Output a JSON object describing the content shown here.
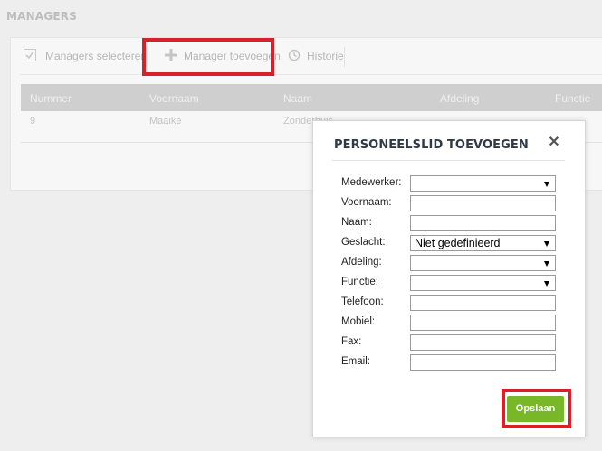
{
  "page": {
    "title": "MANAGERS"
  },
  "toolbar": {
    "select_managers": "Managers selecteren",
    "add_manager": "Manager toevoegen",
    "history": "Historie"
  },
  "table": {
    "columns": [
      "Nummer",
      "Voornaam",
      "Naam",
      "Afdeling",
      "Functie"
    ],
    "rows": [
      {
        "nummer": "9",
        "voornaam": "Maaike",
        "naam": "Zonderhuis"
      }
    ]
  },
  "dialog": {
    "title": "PERSONEELSLID TOEVOEGEN",
    "fields": [
      {
        "label": "Medewerker:",
        "type": "select",
        "value": ""
      },
      {
        "label": "Voornaam:",
        "type": "text",
        "value": ""
      },
      {
        "label": "Naam:",
        "type": "text",
        "value": ""
      },
      {
        "label": "Geslacht:",
        "type": "select",
        "value": "Niet gedefinieerd"
      },
      {
        "label": "Afdeling:",
        "type": "select",
        "value": ""
      },
      {
        "label": "Functie:",
        "type": "select",
        "value": ""
      },
      {
        "label": "Telefoon:",
        "type": "text",
        "value": ""
      },
      {
        "label": "Mobiel:",
        "type": "text",
        "value": ""
      },
      {
        "label": "Fax:",
        "type": "text",
        "value": ""
      },
      {
        "label": "Email:",
        "type": "text",
        "value": ""
      }
    ],
    "save_label": "Opslaan"
  },
  "colors": {
    "highlight": "#d8202a",
    "save_button": "#78b828",
    "table_header": "#cfcfcf"
  },
  "icons": [
    "checkbox-icon",
    "plus-icon",
    "history-icon",
    "close-icon",
    "dropdown-arrow-icon"
  ]
}
